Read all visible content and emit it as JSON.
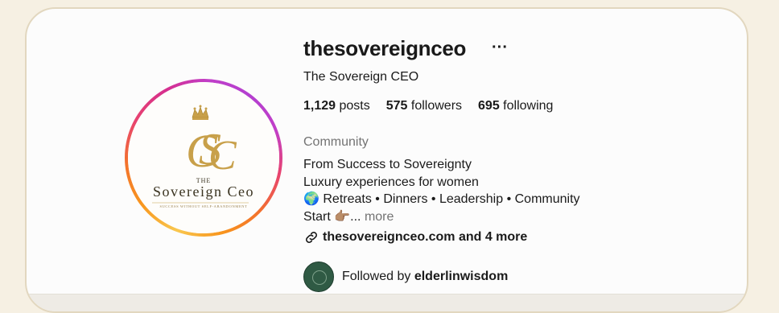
{
  "profile": {
    "username": "thesovereignceo",
    "more_icon": "···",
    "full_name": "The Sovereign CEO",
    "stats": [
      {
        "count": "1,129",
        "label": " posts"
      },
      {
        "count": "575",
        "label": " followers"
      },
      {
        "count": "695",
        "label": " following"
      }
    ],
    "category": "Community",
    "bio": {
      "line1": "From Success to Sovereignty",
      "line2": "Luxury experiences for women",
      "line3": "🌍 Retreats • Dinners • Leadership • Community",
      "line4": "Start 👉🏽...",
      "more_label": " more"
    },
    "link": {
      "icon": "link-icon",
      "text": "thesovereignceo.com and 4 more"
    },
    "followed_by": {
      "prefix": "Followed by ",
      "user": "elderlinwisdom"
    }
  },
  "avatar_logo": {
    "monogram": "SC",
    "the": "THE",
    "name": "Sovereign Ceo",
    "tagline": "SUCCESS WITHOUT SELF-ABANDONMENT"
  },
  "colors": {
    "gold": "#c8a04a",
    "background": "#f6f0e3",
    "card_border": "#e2d7bf",
    "muted_text": "#737373"
  }
}
